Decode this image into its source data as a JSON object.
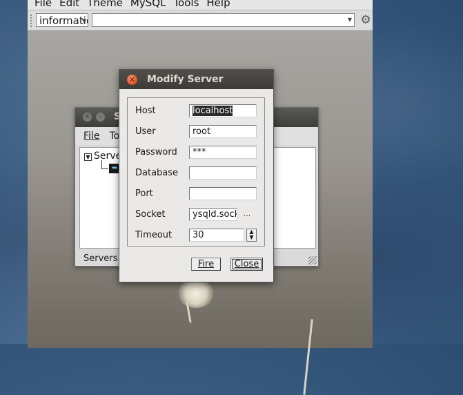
{
  "main_window": {
    "menu": [
      "File",
      "Edit",
      "Theme",
      "MySQL",
      "Tools",
      "Help"
    ],
    "database_combo_value": "information_schema",
    "query_combo_value": ""
  },
  "servers_window": {
    "title": "Servers",
    "title_visible": "S",
    "menu": [
      "File",
      "Tools"
    ],
    "menu_visible": [
      "File",
      "To"
    ],
    "tree_root": "Servers",
    "tree_root_visible": "Server",
    "status": "Servers:"
  },
  "dialog": {
    "title": "Modify Server",
    "fields": {
      "host": {
        "label": "Host",
        "value": "localhost"
      },
      "user": {
        "label": "User",
        "value": "root"
      },
      "password": {
        "label": "Password",
        "value": "***"
      },
      "database": {
        "label": "Database",
        "value": ""
      },
      "port": {
        "label": "Port",
        "value": ""
      },
      "socket": {
        "label": "Socket",
        "value": "ysqld.sock",
        "browse_label": "..."
      },
      "timeout": {
        "label": "Timeout",
        "value": "30"
      }
    },
    "fire_label": "Fire",
    "close_label": "Close"
  },
  "icons": {
    "dialog_close": "close-icon",
    "toolbar_gear": "gear-icon",
    "server_node": "server-icon"
  },
  "colors": {
    "titlebar": "#3c3b37",
    "close_button": "#e25a2b",
    "desktop": "#3d5f84"
  }
}
